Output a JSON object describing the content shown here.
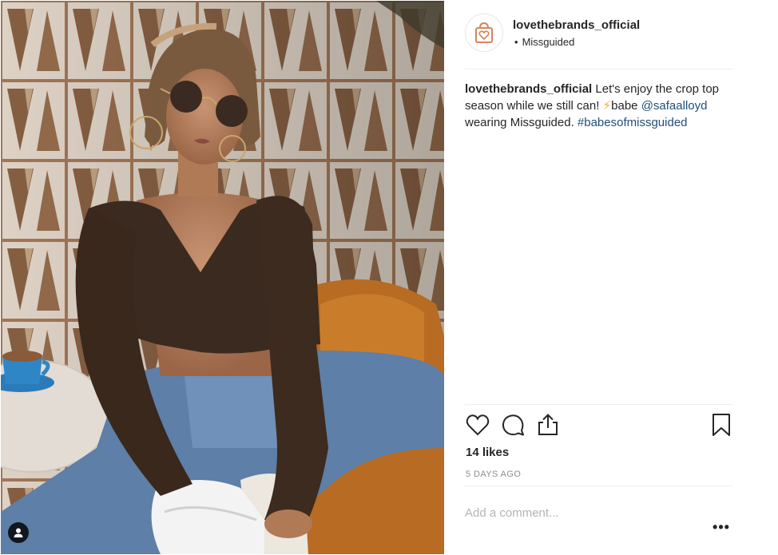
{
  "post": {
    "username": "lovethebrands_official",
    "location": "Missguided",
    "location_dot": "•",
    "caption": {
      "username": "lovethebrands_official",
      "text_1": "Let's enjoy the crop top season while we still can! ",
      "emoji": "⚡",
      "text_2": "babe ",
      "mention": "@safaalloyd",
      "text_3": " wearing Missguided. ",
      "hashtag": "#babesofmissguided"
    },
    "likes": "14 likes",
    "timestamp": "5 DAYS AGO",
    "comment_placeholder": "Add a comment...",
    "more_label": "•••"
  },
  "icons": {
    "avatar": "heart-shopping-bag-logo",
    "like": "heart-outline-icon",
    "comment": "speech-bubble-icon",
    "share": "share-upload-icon",
    "save": "bookmark-icon",
    "tag": "user-silhouette-icon"
  },
  "colors": {
    "text": "#262626",
    "link": "#1f4e79",
    "muted": "#8e8e8e",
    "placeholder": "#b3b3b3",
    "divider": "#efefef",
    "logo": "#d9845a"
  }
}
